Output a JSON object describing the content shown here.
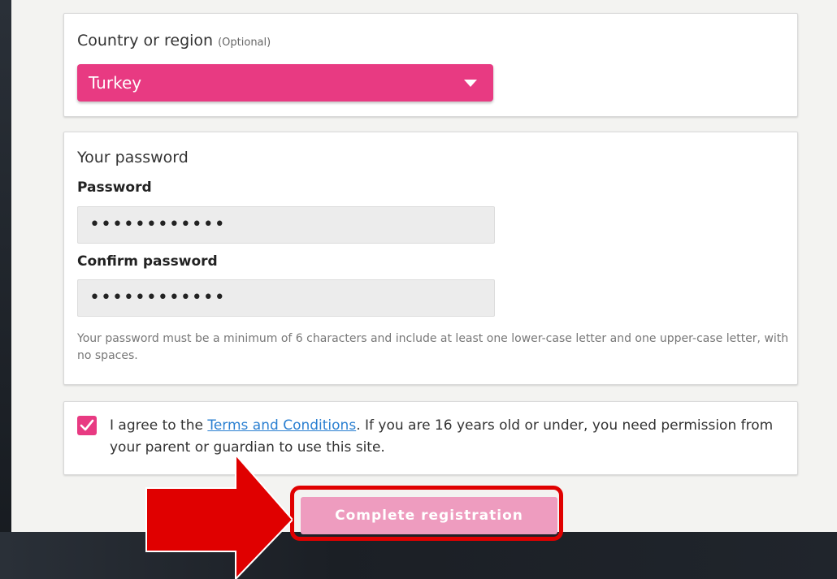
{
  "country": {
    "label": "Country or region",
    "optional": "(Optional)",
    "selected": "Turkey"
  },
  "password_section": {
    "title": "Your password",
    "password_label": "Password",
    "password_value": "••••••••••••",
    "confirm_label": "Confirm password",
    "confirm_value": "••••••••••••",
    "hint": "Your password must be a minimum of 6 characters and include at least one lower-case letter and one upper-case letter, with no spaces."
  },
  "terms": {
    "checked": true,
    "prefix": "I agree to the ",
    "link": "Terms and Conditions",
    "suffix": ". If you are 16 years old or under, you need permission from your parent or guardian to use this site."
  },
  "actions": {
    "complete_label": "Complete registration"
  },
  "colors": {
    "accent": "#e83a82",
    "button_disabled": "#ee9cbf",
    "link": "#2a7fd1",
    "annotation": "#e00000"
  }
}
